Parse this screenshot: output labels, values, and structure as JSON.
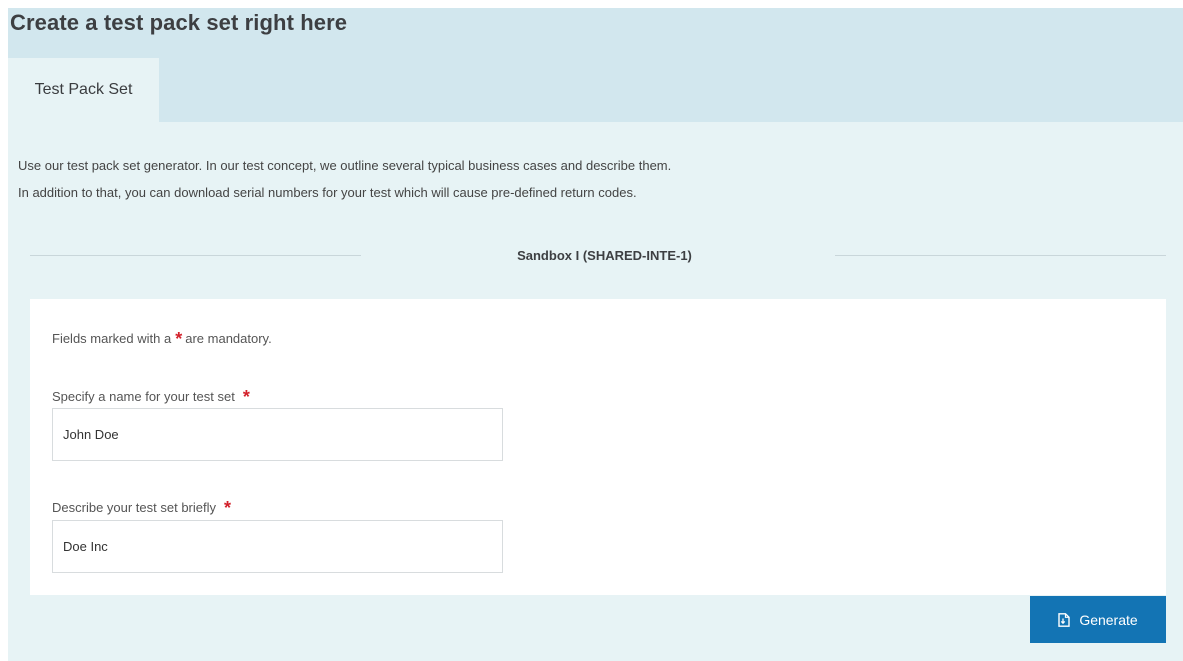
{
  "page": {
    "title": "Create a test pack set right here"
  },
  "tabs": [
    {
      "label": "Test Pack Set",
      "active": true
    }
  ],
  "intro": {
    "line1": "Use our test pack set generator. In our test concept, we outline several typical business cases and describe them.",
    "line2": "In addition to that, you can download serial numbers for your test which will cause pre-defined return codes."
  },
  "section": {
    "title": "Sandbox I (SHARED-INTE-1)"
  },
  "form": {
    "mandatory_prefix": "Fields marked with a",
    "required_marker": "*",
    "mandatory_suffix": "are mandatory.",
    "name_label": "Specify a name for your test set",
    "name_value": "John Doe",
    "description_label": "Describe your test set briefly",
    "description_value": "Doe Inc",
    "generate_label": "Generate",
    "generate_icon": "file-download-icon"
  },
  "colors": {
    "header_bg": "#d2e7ee",
    "page_bg": "#e7f3f5",
    "accent": "#1374b4",
    "required": "#d3212b"
  }
}
